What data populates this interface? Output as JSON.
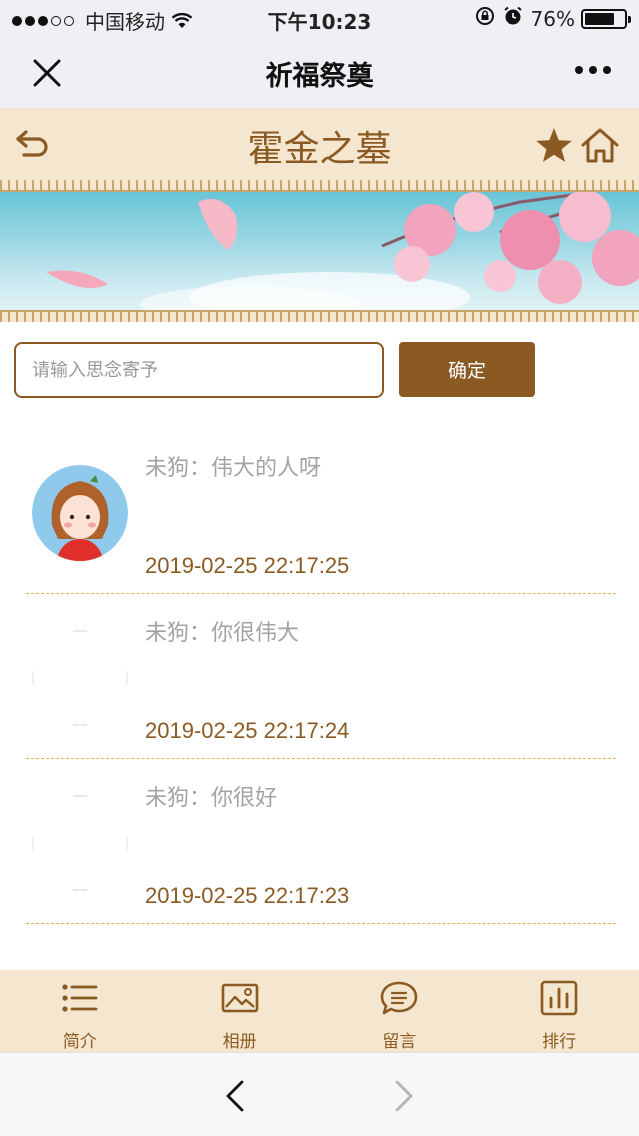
{
  "status_bar": {
    "carrier": "中国移动",
    "time": "下午10:23",
    "battery_text": "76%",
    "battery_level": 0.76,
    "icons": [
      "signal-dots-icon",
      "wifi-icon",
      "rotation-lock-icon",
      "alarm-icon",
      "battery-icon"
    ]
  },
  "nav_bar": {
    "title": "祈福祭奠",
    "icons": [
      "close-icon",
      "more-icon"
    ]
  },
  "page_header": {
    "name": "霍金之墓",
    "icons": [
      "back-icon",
      "star-icon",
      "home-icon"
    ]
  },
  "banner": {
    "icons": [
      "magnolia-banner-image"
    ]
  },
  "input": {
    "placeholder": "请输入思念寄予",
    "value": "",
    "button_label": "确定"
  },
  "messages": [
    {
      "text": "未狗：伟大的人呀",
      "time": "2019-02-25 22:17:25",
      "avatar": "girl-avatar-icon"
    },
    {
      "text": "未狗：你很伟大",
      "time": "2019-02-25 22:17:24",
      "avatar": "blank-avatar"
    },
    {
      "text": "未狗：你很好",
      "time": "2019-02-25 22:17:23",
      "avatar": "blank-avatar"
    }
  ],
  "tabs": [
    {
      "label": "简介",
      "icon": "list-icon"
    },
    {
      "label": "相册",
      "icon": "photo-icon"
    },
    {
      "label": "留言",
      "icon": "message-icon"
    },
    {
      "label": "排行",
      "icon": "ranking-icon"
    }
  ],
  "browser_bar": {
    "icons": [
      "back-arrow-icon",
      "forward-arrow-icon"
    ]
  },
  "colors": {
    "brand_brown": "#8b5a22",
    "header_bg": "#f4e6cf",
    "divider_gold": "#e0b44a",
    "message_gray": "#a3a3a3"
  }
}
